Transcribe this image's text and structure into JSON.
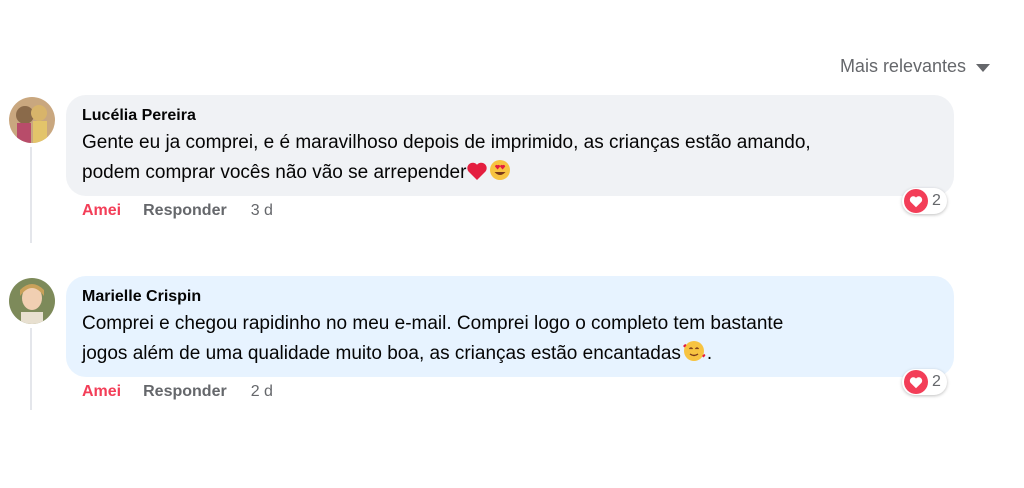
{
  "sort": {
    "label": "Mais relevantes"
  },
  "comments": [
    {
      "author": "Lucélia Pereira",
      "text_lines": [
        "Gente eu ja comprei, e é maravilhoso depois de imprimido, as crianças estão amando,",
        "podem comprar vocês não vão se arrepender"
      ],
      "reaction_count": "2",
      "like_label": "Amei",
      "reply_label": "Responder",
      "time": "3 d"
    },
    {
      "author": "Marielle Crispin",
      "text_lines": [
        "Comprei e chegou rapidinho no meu e-mail. Comprei logo o completo tem bastante",
        "jogos além de uma qualidade muito boa, as crianças estão encantadas",
        "."
      ],
      "reaction_count": "2",
      "like_label": "Amei",
      "reply_label": "Responder",
      "time": "2 d"
    }
  ],
  "colors": {
    "love": "#f33e58",
    "bubble_default": "#f0f2f5",
    "bubble_highlight": "#e7f3ff",
    "secondary_text": "#65676b"
  },
  "icons": [
    "chevron-down-icon",
    "heart-icon",
    "heart-eyes-emoji-icon",
    "smiling-face-with-hearts-emoji-icon"
  ]
}
